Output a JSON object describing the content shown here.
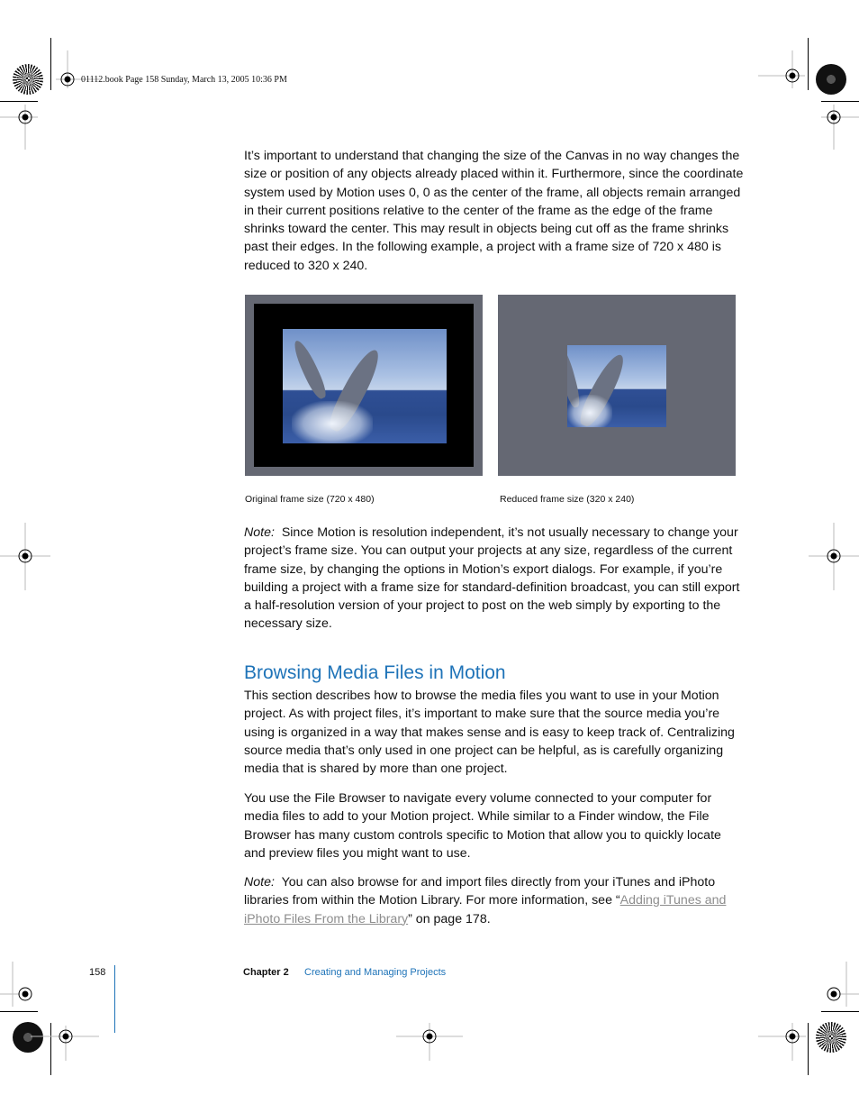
{
  "slug": "01112.book  Page 158  Sunday, March 13, 2005  10:36 PM",
  "intro_paragraph": "It’s important to understand that changing the size of the Canvas in no way changes the size or position of any objects already placed within it. Furthermore, since the coordinate system used by Motion uses 0, 0 as the center of the frame, all objects remain arranged in their current positions relative to the center of the frame as the edge of the frame shrinks toward the center. This may result in objects being cut off as the frame shrinks past their edges. In the following example, a project with a frame size of 720 x 480 is reduced to 320 x 240.",
  "figures": [
    {
      "caption": "Original frame size (720 x 480)",
      "image": "dolphins-original-frame"
    },
    {
      "caption": "Reduced frame size (320 x 240)",
      "image": "dolphins-reduced-frame"
    }
  ],
  "note1": {
    "label": "Note:",
    "text": "Since Motion is resolution independent, it’s not usually necessary to change your project’s frame size. You can output your projects at any size, regardless of the current frame size, by changing the options in Motion’s export dialogs. For example, if you’re building a project with a frame size for standard-definition broadcast, you can still export a half-resolution version of your project to post on the web simply by exporting to the necessary size."
  },
  "section": {
    "heading": "Browsing Media Files in Motion",
    "paragraph1": "This section describes how to browse the media files you want to use in your Motion project. As with project files, it’s important to make sure that the source media you’re using is organized in a way that makes sense and is easy to keep track of. Centralizing source media that’s only used in one project can be helpful, as is carefully organizing media that is shared by more than one project.",
    "paragraph2": "You use the File Browser to navigate every volume connected to your computer for media files to add to your Motion project. While similar to a Finder window, the File Browser has many custom controls specific to Motion that allow you to quickly locate and preview files you might want to use."
  },
  "note2": {
    "label": "Note:",
    "text_before": "You can also browse for and import files directly from your iTunes and iPhoto libraries from within the Motion Library. For more information, see “",
    "link_text": "Adding iTunes and iPhoto Files From the Library",
    "text_after": "” on page 178."
  },
  "footer": {
    "page_number": "158",
    "chapter_label": "Chapter 2",
    "chapter_title": "Creating and Managing Projects"
  },
  "colors": {
    "accent_blue": "#1e73b8",
    "link_gray": "#8d8d8d",
    "canvas_gray": "#656873"
  }
}
